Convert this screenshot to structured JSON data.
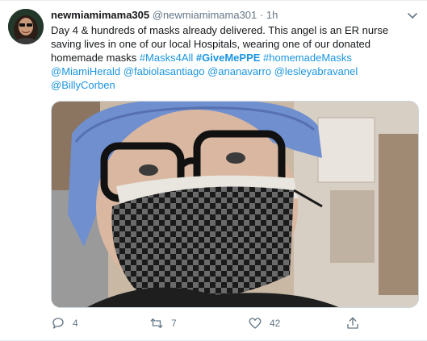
{
  "tweet": {
    "display_name": "newmiamimama305",
    "handle": "@newmiamimama301",
    "dot": "·",
    "time": "1h",
    "text_plain": "Day 4 & hundreds of masks already delivered. This angel is an ER nurse saving lives in one of our local Hospitals, wearing one of our donated homemade masks ",
    "hashtag1": "#Masks4All",
    "hashtag2": "#GiveMePPE",
    "hashtag3": "#homemadeMasks",
    "mention1": "@MiamiHerald",
    "mention2": "@fabiolasantiago",
    "mention3": "@ananavarro",
    "mention4": "@lesleyabravanel",
    "mention5": "@BillyCorben"
  },
  "actions": {
    "replies": "4",
    "retweets": "7",
    "likes": "42"
  },
  "icons": {
    "caret": "chevron-down-icon",
    "reply": "reply-icon",
    "retweet": "retweet-icon",
    "like": "heart-icon",
    "share": "share-icon"
  },
  "colors": {
    "link": "#1b95e0",
    "muted": "#657786",
    "text": "#14171a"
  }
}
